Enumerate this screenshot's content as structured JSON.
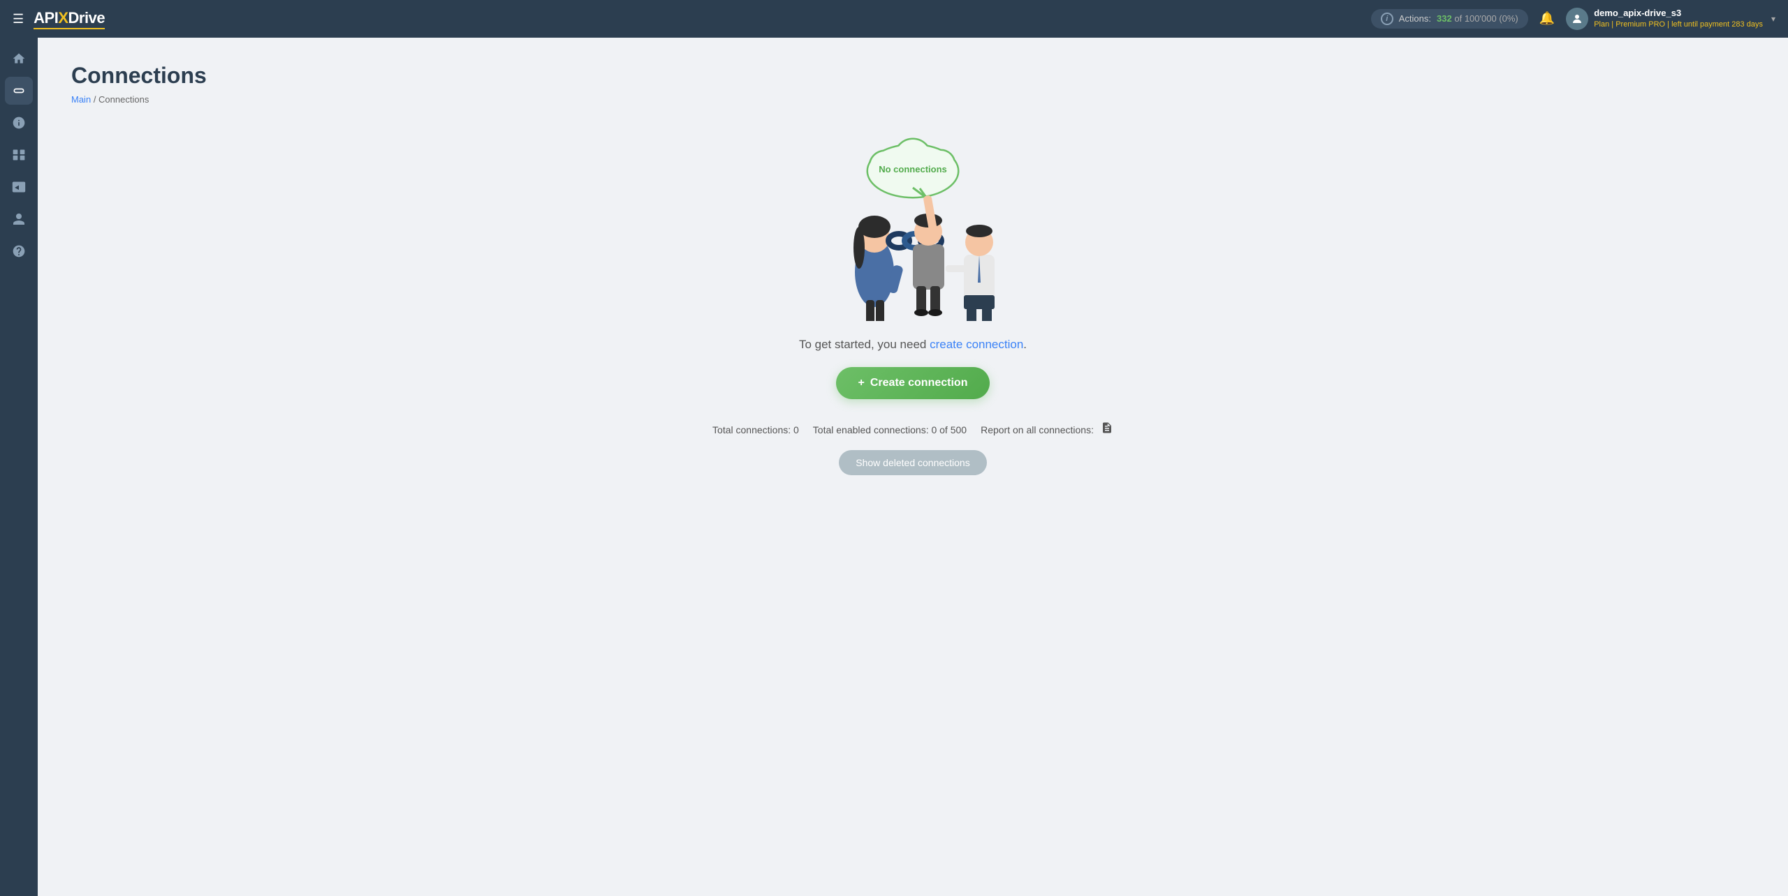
{
  "app": {
    "name": "APIXDrive",
    "logo_api": "API",
    "logo_x": "X",
    "logo_drive": "Drive"
  },
  "topnav": {
    "actions_label": "Actions:",
    "actions_count": "332",
    "actions_separator": "of",
    "actions_total": "100'000",
    "actions_percent": "(0%)",
    "bell_icon": "🔔",
    "user_name": "demo_apix-drive_s3",
    "user_plan_label": "Plan |",
    "user_plan": "Premium PRO",
    "user_plan_suffix": "| left until payment",
    "user_days": "283",
    "user_days_suffix": "days",
    "chevron": "▾"
  },
  "sidebar": {
    "items": [
      {
        "icon": "⌂",
        "label": "home",
        "active": false
      },
      {
        "icon": "⛓",
        "label": "connections",
        "active": true
      },
      {
        "icon": "$",
        "label": "billing",
        "active": false
      },
      {
        "icon": "💼",
        "label": "services",
        "active": false
      },
      {
        "icon": "▶",
        "label": "video",
        "active": false
      },
      {
        "icon": "👤",
        "label": "account",
        "active": false
      },
      {
        "icon": "?",
        "label": "help",
        "active": false
      }
    ]
  },
  "page": {
    "title": "Connections",
    "breadcrumb_main": "Main",
    "breadcrumb_separator": " / ",
    "breadcrumb_current": "Connections"
  },
  "empty_state": {
    "cloud_text": "No connections",
    "description_prefix": "To get started, you need ",
    "description_link": "create connection",
    "description_suffix": ".",
    "create_button_icon": "+",
    "create_button_label": "Create connection",
    "stats_total_label": "Total connections: 0",
    "stats_enabled_label": "Total enabled connections: 0 of 500",
    "stats_report_label": "Report on all connections:",
    "show_deleted_label": "Show deleted connections"
  }
}
